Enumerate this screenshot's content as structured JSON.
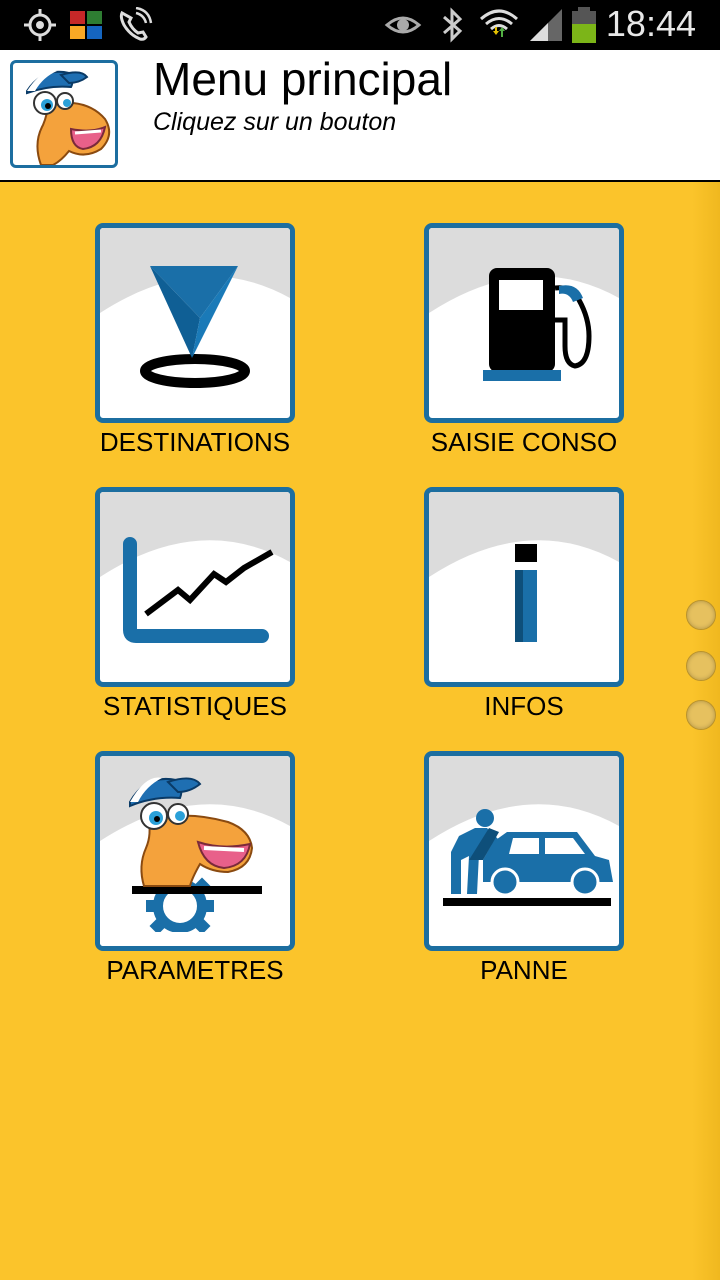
{
  "status_bar": {
    "time": "18:44",
    "icons": [
      "gps-icon",
      "avg-icon",
      "wifi-call-icon",
      "eye-icon",
      "bluetooth-icon",
      "wifi-icon",
      "signal-icon",
      "battery-icon"
    ]
  },
  "header": {
    "title": "Menu principal",
    "subtitle": "Cliquez sur un bouton",
    "logo": "camel-mascot-logo"
  },
  "menu": [
    {
      "label": "DESTINATIONS",
      "icon": "map-pin-icon"
    },
    {
      "label": "SAISIE CONSO",
      "icon": "fuel-pump-icon"
    },
    {
      "label": "STATISTIQUES",
      "icon": "chart-icon"
    },
    {
      "label": "INFOS",
      "icon": "info-icon"
    },
    {
      "label": "PARAMETRES",
      "icon": "camel-gear-icon"
    },
    {
      "label": "PANNE",
      "icon": "car-repair-icon"
    }
  ],
  "colors": {
    "background": "#fbc42b",
    "tile_border": "#1c6ea0",
    "icon_blue": "#0f73a8"
  },
  "page_indicator": {
    "pages": 3
  }
}
